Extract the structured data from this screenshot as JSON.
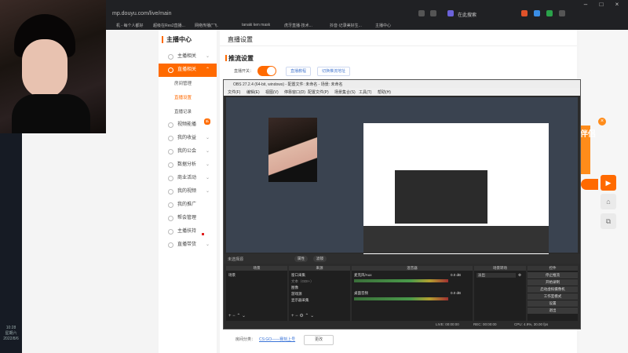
{
  "browser": {
    "url": "mp.douyu.com/live/main",
    "search_placeholder": "在此搜索",
    "bookmarks": [
      "机 - 每个人都好",
      "超级在Res2直播...",
      "网络传播(\"飞.",
      "tanaki ken mask",
      "虎牙直播·技术...",
      "抖音·记录美好生...",
      "主播中心"
    ]
  },
  "desktop": {
    "time": "10:28",
    "weekday": "星期六",
    "date": "2022/8/6"
  },
  "sidebar": {
    "title": "主播中心",
    "items": [
      {
        "label": "主播相关"
      },
      {
        "label": "直播相关",
        "active": true
      },
      {
        "label": "视频能播"
      },
      {
        "label": "我的收益"
      },
      {
        "label": "我的公会"
      },
      {
        "label": "数据分析"
      },
      {
        "label": "商业活动"
      },
      {
        "label": "我的视频"
      },
      {
        "label": "我的推广"
      },
      {
        "label": "帮会管理"
      },
      {
        "label": "主播扶持"
      },
      {
        "label": "直播带货"
      }
    ],
    "subitems": [
      {
        "label": "房间管理"
      },
      {
        "label": "直播设置",
        "current": true
      },
      {
        "label": "直播记录"
      }
    ],
    "badge": "新"
  },
  "main": {
    "title": "直播设置",
    "section_title": "推流设置",
    "switch_label": "直播开关：",
    "switch_on": true,
    "link_tutorial": "直播教程",
    "link_tool": "切换推流地址",
    "room_category_label": "房间分类：",
    "room_category_value": "CS:GO——赛刻上号",
    "change_button": "更改"
  },
  "promo": {
    "text": "伴侣",
    "close": "×"
  },
  "obs": {
    "title": "OBS 27.2.4 (64-bit, windows) - 配置文件: 未命名 - 场景: 未命名",
    "menu": [
      "文件(F)",
      "编辑(E)",
      "视图(V)",
      "停靠窗口(D)",
      "配置文件(P)",
      "场景集合(S)",
      "工具(T)",
      "帮助(H)"
    ],
    "no_source": "未选择源",
    "props_btn": "属性",
    "filter_btn": "滤镜",
    "docks": {
      "scenes": {
        "title": "场景",
        "items": [
          "场景"
        ]
      },
      "sources": {
        "title": "来源",
        "items": [
          "窗口采集",
          "文本（GDI+）",
          "图像",
          "游戏源",
          "显示器采集"
        ]
      },
      "mixer": {
        "title": "混音器",
        "tracks": [
          {
            "name": "麦克风/Aux",
            "level": "0.0 dB"
          },
          {
            "name": "桌面音频",
            "level": "0.0 dB"
          }
        ]
      },
      "transitions": {
        "title": "场景转场",
        "value": "淡出"
      },
      "controls": {
        "title": "控件",
        "buttons": [
          "停止推流",
          "开始录制",
          "启动虚拟摄像机",
          "工作室模式",
          "设置",
          "退出"
        ]
      }
    },
    "status": {
      "live": "LIVE: 00:00:00",
      "rec": "REC: 00:00:00",
      "cpu": "CPU: 4.9%, 30.00 fps"
    }
  },
  "colors": {
    "accent": "#ff6a00",
    "link": "#3a74d8"
  }
}
